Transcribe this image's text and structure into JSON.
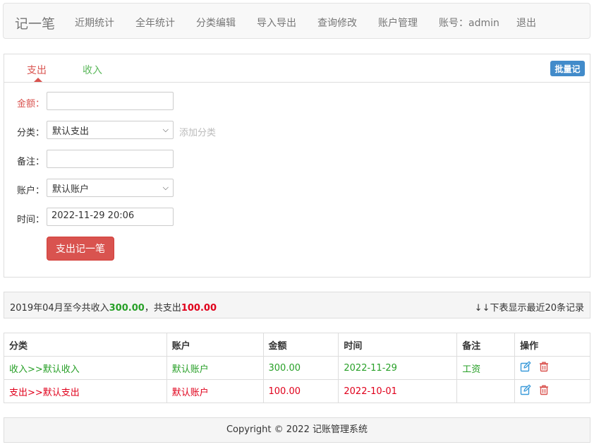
{
  "nav": {
    "brand": "记一笔",
    "items": [
      "近期统计",
      "全年统计",
      "分类编辑",
      "导入导出",
      "查询修改",
      "账户管理",
      "账号：admin",
      "退出"
    ]
  },
  "form": {
    "tabs": {
      "expense": "支出",
      "income": "收入"
    },
    "batch_label": "批量记",
    "amount_label": "金额：",
    "amount_value": "",
    "category_label": "分类：",
    "category_value": "默认支出",
    "add_category": "添加分类",
    "note_label": "备注：",
    "note_value": "",
    "account_label": "账户：",
    "account_value": "默认账户",
    "time_label": "时间：",
    "time_value": "2022-11-29 20:06",
    "submit_label": "支出记一笔"
  },
  "summary": {
    "prefix": "2019年04月至今共收入",
    "income_total": "300.00",
    "middle": "，共支出",
    "expense_total": "100.00",
    "right": "↓↓下表显示最近20条记录"
  },
  "table": {
    "headers": [
      "分类",
      "账户",
      "金额",
      "时间",
      "备注",
      "操作"
    ],
    "rows": [
      {
        "category": "收入>>默认收入",
        "account": "默认账户",
        "amount": "300.00",
        "time": "2022-11-29",
        "note": "工资"
      },
      {
        "category": "支出>>默认支出",
        "account": "默认账户",
        "amount": "100.00",
        "time": "2022-10-01",
        "note": ""
      }
    ]
  },
  "footer": "Copyright © 2022 记账管理系统",
  "colors": {
    "expense": "#d9534f",
    "income": "#28a028",
    "primary": "#428bca"
  },
  "icons": {
    "edit": "edit-icon",
    "delete": "trash-icon"
  }
}
